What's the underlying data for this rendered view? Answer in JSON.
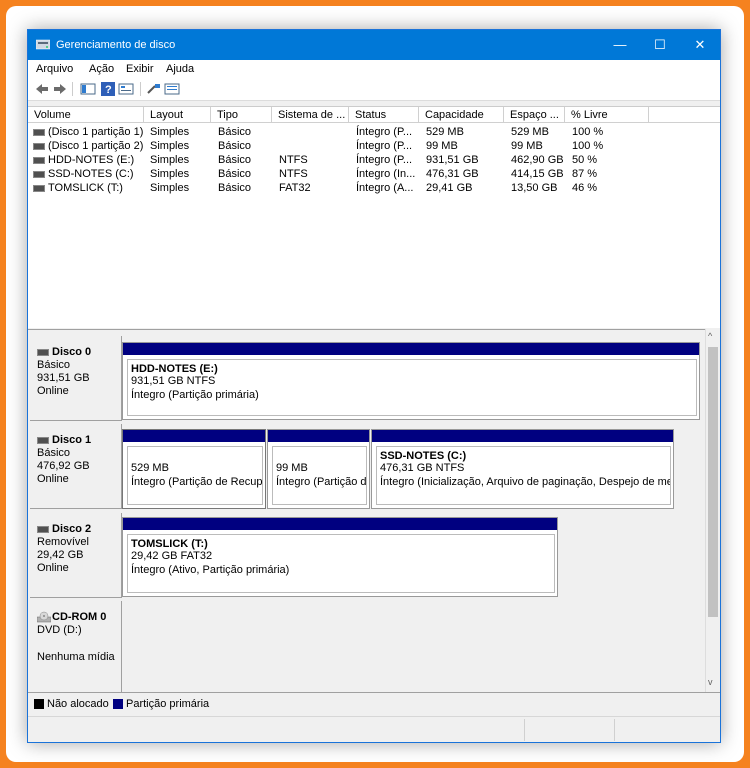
{
  "window": {
    "title": "Gerenciamento de disco",
    "minimize": "—",
    "maximize": "☐",
    "close": "✕"
  },
  "menu": [
    "Arquivo",
    "Ação",
    "Exibir",
    "Ajuda"
  ],
  "toolbar": {
    "icons": [
      "back-arrow-icon",
      "forward-arrow-icon",
      "properties-icon",
      "help-icon",
      "console-icon",
      "connect-icon",
      "list-icon"
    ]
  },
  "volume_table": {
    "columns": [
      "Volume",
      "Layout",
      "Tipo",
      "Sistema de ...",
      "Status",
      "Capacidade",
      "Espaço ...",
      "% Livre"
    ],
    "rows": [
      [
        "(Disco 1 partição 1)",
        "Simples",
        "Básico",
        "",
        "Íntegro (P...",
        "529 MB",
        "529 MB",
        "100 %"
      ],
      [
        "(Disco 1 partição 2)",
        "Simples",
        "Básico",
        "",
        "Íntegro (P...",
        "99 MB",
        "99 MB",
        "100 %"
      ],
      [
        "HDD-NOTES (E:)",
        "Simples",
        "Básico",
        "NTFS",
        "Íntegro (P...",
        "931,51 GB",
        "462,90 GB",
        "50 %"
      ],
      [
        "SSD-NOTES (C:)",
        "Simples",
        "Básico",
        "NTFS",
        "Íntegro (In...",
        "476,31 GB",
        "414,15 GB",
        "87 %"
      ],
      [
        "TOMSLICK (T:)",
        "Simples",
        "Básico",
        "FAT32",
        "Íntegro (A...",
        "29,41 GB",
        "13,50 GB",
        "46 %"
      ]
    ]
  },
  "disks": [
    {
      "name": "Disco 0",
      "type": "Básico",
      "size": "931,51 GB",
      "state": "Online",
      "partitions": [
        {
          "name": "HDD-NOTES  (E:)",
          "size": "931,51 GB NTFS",
          "status": "Íntegro (Partição primária)"
        }
      ]
    },
    {
      "name": "Disco 1",
      "type": "Básico",
      "size": "476,92 GB",
      "state": "Online",
      "partitions": [
        {
          "name": "",
          "size": "529 MB",
          "status": "Íntegro (Partição de Recuperação)"
        },
        {
          "name": "",
          "size": "99 MB",
          "status": "Íntegro (Partição de Sistema EFI)"
        },
        {
          "name": "SSD-NOTES  (C:)",
          "size": "476,31 GB NTFS",
          "status": "Íntegro (Inicialização, Arquivo de paginação, Despejo de memória, Partição primária)"
        }
      ]
    },
    {
      "name": "Disco 2",
      "type": "Removível",
      "size": "29,42 GB",
      "state": "Online",
      "partitions": [
        {
          "name": "TOMSLICK  (T:)",
          "size": "29,42 GB FAT32",
          "status": "Íntegro (Ativo, Partição primária)"
        }
      ]
    },
    {
      "name": "CD-ROM 0",
      "type": "DVD (D:)",
      "size": "",
      "state": "Nenhuma mídia",
      "partitions": []
    }
  ],
  "legend": {
    "unallocated": "Não alocado",
    "primary": "Partição primária",
    "unallocated_color": "#000000",
    "primary_color": "#000080"
  },
  "colors": {
    "titlebar": "#0078d7",
    "partition_bar": "#000080",
    "frame": "#f5821f"
  }
}
